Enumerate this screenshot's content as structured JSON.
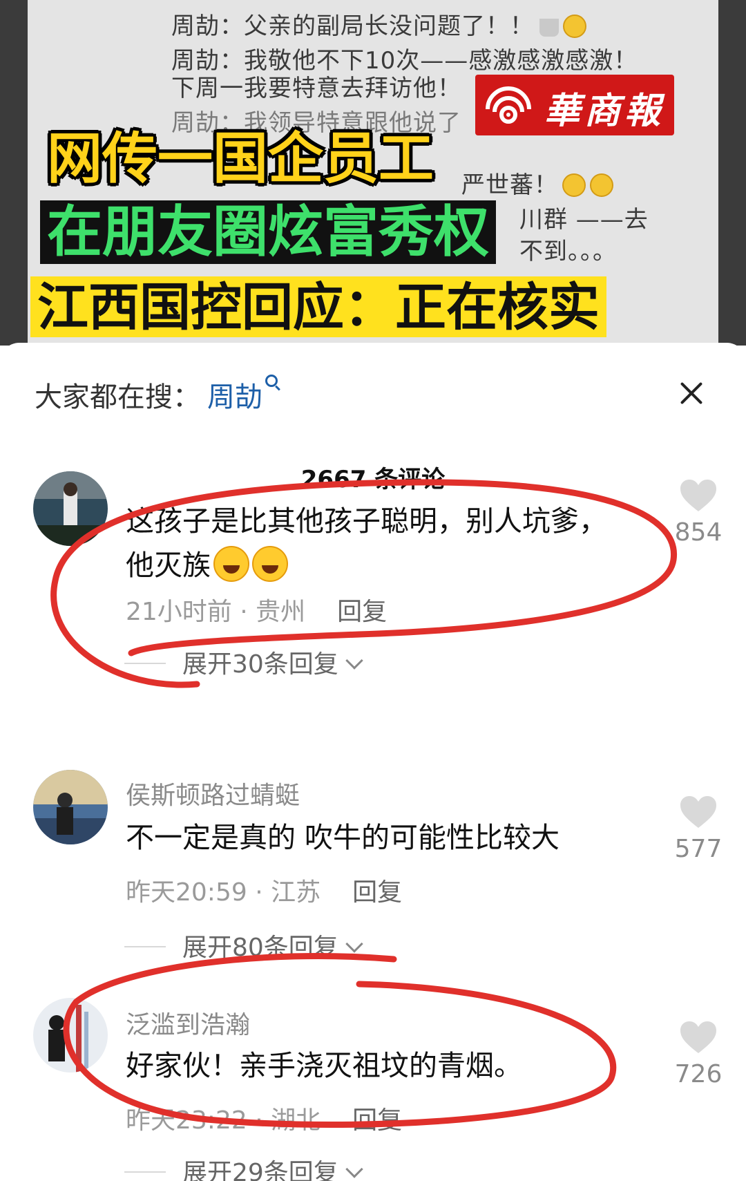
{
  "video": {
    "chat_lines": [
      "周劼：父亲的副局长没问题了！！",
      "周劼：我敬他不下10次——感激感激感激！",
      "下周一我要特意去拜访他！",
      "周劼：我领导特意跟他说了",
      "严世蕃！",
      "川群 ——去",
      "不到。。。"
    ],
    "logo_text": "華商報",
    "headline_1": "网传一国企员工",
    "headline_2": "在朋友圈炫富秀权",
    "headline_3": "江西国控回应：正在核实"
  },
  "search": {
    "label": "大家都在搜：",
    "term": "周劼"
  },
  "comment_count": "2667 条评论",
  "comments": [
    {
      "username": "",
      "text": "这孩子是比其他孩子聪明，别人坑爹，他灭族",
      "time": "21小时前",
      "location": "贵州",
      "reply": "回复",
      "likes": "854",
      "expand": "展开30条回复"
    },
    {
      "username": "侯斯顿路过蜻蜓",
      "text": "不一定是真的 吹牛的可能性比较大",
      "time": "昨天20:59",
      "location": "江苏",
      "reply": "回复",
      "likes": "577",
      "expand": "展开80条回复"
    },
    {
      "username": "泛滥到浩瀚",
      "text": "好家伙！亲手浇灭祖坟的青烟。",
      "time": "昨天23:22",
      "location": "湖北",
      "reply": "回复",
      "likes": "726",
      "expand": "展开29条回复"
    }
  ],
  "colors": {
    "headline_yellow": "#ffd21a",
    "headline_green": "#3ee06b",
    "search_blue": "#1d5fa8",
    "annotation_red": "#e0302b",
    "logo_red": "#d01818"
  }
}
